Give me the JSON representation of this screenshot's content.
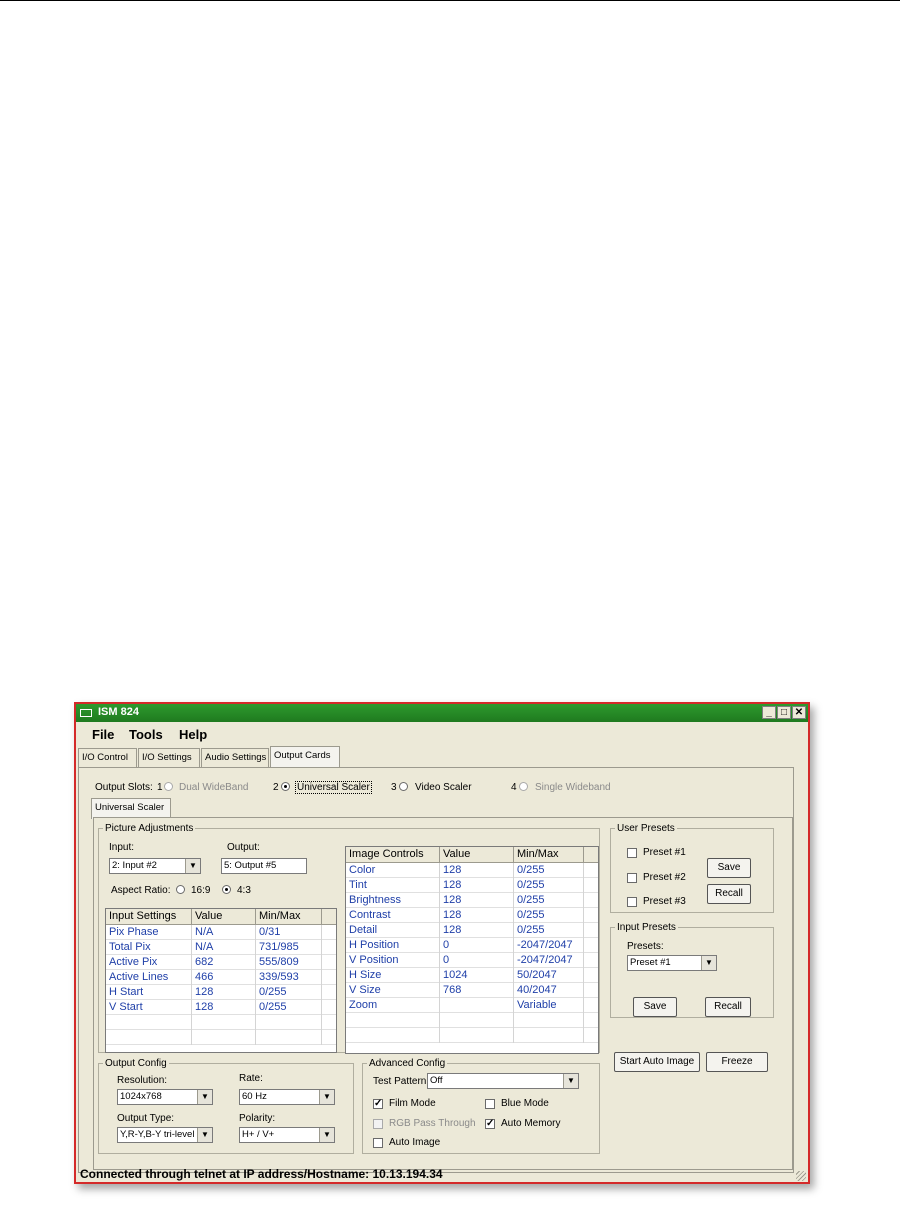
{
  "window": {
    "title": "ISM 824",
    "controls": {
      "minimize": "_",
      "maximize": "□",
      "close": "✕"
    }
  },
  "menu": [
    "File",
    "Tools",
    "Help"
  ],
  "tabs": [
    "I/O Control",
    "I/O Settings",
    "Audio Settings",
    "Output Cards"
  ],
  "output_slots": {
    "label": "Output Slots:",
    "slots": [
      {
        "num": "1",
        "name": "Dual WideBand",
        "selected": false,
        "enabled": false
      },
      {
        "num": "2",
        "name": "Universal Scaler",
        "selected": true,
        "enabled": true
      },
      {
        "num": "3",
        "name": "Video Scaler",
        "selected": false,
        "enabled": true
      },
      {
        "num": "4",
        "name": "Single Wideband",
        "selected": false,
        "enabled": false
      }
    ]
  },
  "subtab": "Universal Scaler",
  "picture_adjustments": {
    "legend": "Picture Adjustments",
    "input_label": "Input:",
    "input_value": "2: Input #2",
    "output_label": "Output:",
    "output_value": "5: Output #5",
    "aspect_label": "Aspect Ratio:",
    "aspect_options": [
      "16:9",
      "4:3"
    ],
    "aspect_selected": "4:3"
  },
  "input_settings": {
    "headers": [
      "Input Settings",
      "Value",
      "Min/Max"
    ],
    "rows": [
      [
        "Pix Phase",
        "N/A",
        "0/31"
      ],
      [
        "Total Pix",
        "N/A",
        "731/985"
      ],
      [
        "Active Pix",
        "682",
        "555/809"
      ],
      [
        "Active Lines",
        "466",
        "339/593"
      ],
      [
        "H Start",
        "128",
        "0/255"
      ],
      [
        "V Start",
        "128",
        "0/255"
      ]
    ]
  },
  "image_controls": {
    "headers": [
      "Image Controls",
      "Value",
      "Min/Max"
    ],
    "rows": [
      [
        "Color",
        "128",
        "0/255"
      ],
      [
        "Tint",
        "128",
        "0/255"
      ],
      [
        "Brightness",
        "128",
        "0/255"
      ],
      [
        "Contrast",
        "128",
        "0/255"
      ],
      [
        "Detail",
        "128",
        "0/255"
      ],
      [
        "H Position",
        "0",
        "-2047/2047"
      ],
      [
        "V Position",
        "0",
        "-2047/2047"
      ],
      [
        "H Size",
        "1024",
        "50/2047"
      ],
      [
        "V Size",
        "768",
        "40/2047"
      ],
      [
        "Zoom",
        "",
        "Variable"
      ]
    ]
  },
  "user_presets": {
    "legend": "User Presets",
    "items": [
      "Preset #1",
      "Preset #2",
      "Preset #3"
    ],
    "save": "Save",
    "recall": "Recall"
  },
  "input_presets": {
    "legend": "Input Presets",
    "presets_label": "Presets:",
    "presets_value": "Preset #1",
    "save": "Save",
    "recall": "Recall"
  },
  "actions": {
    "start_auto_image": "Start Auto Image",
    "freeze": "Freeze"
  },
  "output_config": {
    "legend": "Output Config",
    "resolution_label": "Resolution:",
    "resolution_value": "1024x768",
    "rate_label": "Rate:",
    "rate_value": "60 Hz",
    "output_type_label": "Output Type:",
    "output_type_value": "Y,R-Y,B-Y tri-level",
    "polarity_label": "Polarity:",
    "polarity_value": "H+ / V+"
  },
  "advanced_config": {
    "legend": "Advanced Config",
    "test_pattern_label": "Test Pattern:",
    "test_pattern_value": "Off",
    "film_mode": {
      "label": "Film Mode",
      "checked": true
    },
    "blue_mode": {
      "label": "Blue Mode",
      "checked": false
    },
    "rgb_pass_through": {
      "label": "RGB Pass Through",
      "checked": false,
      "enabled": false
    },
    "auto_memory": {
      "label": "Auto Memory",
      "checked": true
    },
    "auto_image": {
      "label": "Auto Image",
      "checked": false
    }
  },
  "status": "Connected through telnet at IP address/Hostname: 10.13.194.34"
}
